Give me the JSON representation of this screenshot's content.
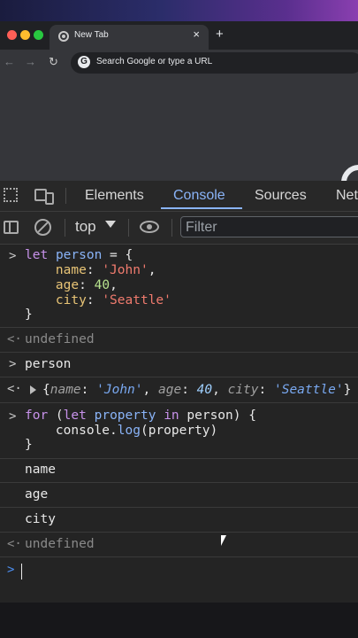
{
  "browser": {
    "tab_title": "New Tab",
    "tab_close": "×",
    "new_tab": "+",
    "back": "←",
    "forward": "→",
    "reload": "↻",
    "omnibox_g": "G",
    "omnibox_placeholder": "Search Google or type a URL"
  },
  "devtools": {
    "tabs": [
      "Elements",
      "Console",
      "Sources",
      "Net"
    ],
    "active_tab": "Console",
    "context": "top",
    "filter_placeholder": "Filter"
  },
  "console": {
    "prompt_in": ">",
    "prompt_out": "<·",
    "entries": {
      "let_kw": "let",
      "person_var": "person",
      "eq_brace": " = {",
      "name_key": "name",
      "name_val": "'John'",
      "age_key": "age",
      "age_val": "40",
      "city_key": "city",
      "city_val": "'Seattle'",
      "close_brace": "}",
      "undefined1": "undefined",
      "person_input": "person",
      "obj_name_key": "name",
      "obj_name_val": "'John'",
      "obj_age_key": "age",
      "obj_age_val": "40",
      "obj_city_key": "city",
      "obj_city_val": "'Seattle'",
      "for_kw": "for",
      "for_let": "let",
      "property_var": "property",
      "in_kw": "in",
      "for_rest": " person) {",
      "console_obj": "console.",
      "log_fn": "log",
      "log_args": "(property)",
      "close_brace2": "}",
      "out_name": "name",
      "out_age": "age",
      "out_city": "city",
      "undefined2": "undefined"
    }
  },
  "colors": {
    "accent": "#8ab4f8",
    "keyword": "#c792ea",
    "string": "#f07b6e",
    "number": "#b7e38e",
    "key": "#e8c476"
  }
}
